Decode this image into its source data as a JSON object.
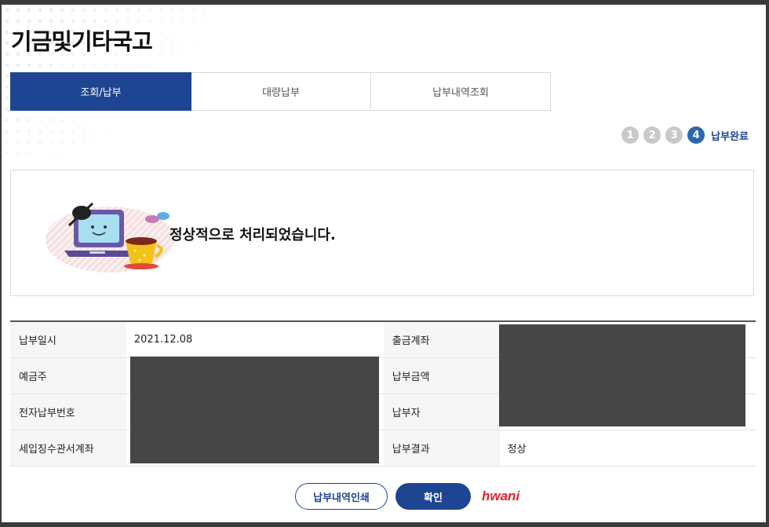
{
  "page": {
    "title": "기금및기타국고"
  },
  "tabs": [
    {
      "label": "조회/납부",
      "active": true
    },
    {
      "label": "대량납부",
      "active": false
    },
    {
      "label": "납부내역조회",
      "active": false
    }
  ],
  "steps": {
    "items": [
      "1",
      "2",
      "3",
      "4"
    ],
    "current": "4",
    "current_label": "납부완료"
  },
  "message": {
    "text": "정상적으로 처리되었습니다."
  },
  "info": {
    "rows": [
      {
        "left_label": "납부일시",
        "left_value": "2021.12.08",
        "right_label": "출금계좌",
        "right_value": ""
      },
      {
        "left_label": "예금주",
        "left_value": "",
        "right_label": "납부금액",
        "right_value": ""
      },
      {
        "left_label": "전자납부번호",
        "left_value": "",
        "right_label": "납부자",
        "right_value": ""
      },
      {
        "left_label": "세입징수관서계좌",
        "left_value": "",
        "right_label": "납부결과",
        "right_value": "정상"
      }
    ]
  },
  "actions": {
    "print_label": "납부내역인쇄",
    "confirm_label": "확인"
  },
  "brand": {
    "text": "hwani"
  },
  "colors": {
    "primary": "#1e4591",
    "step_active": "#2a67b3",
    "brand": "#e2232b"
  }
}
